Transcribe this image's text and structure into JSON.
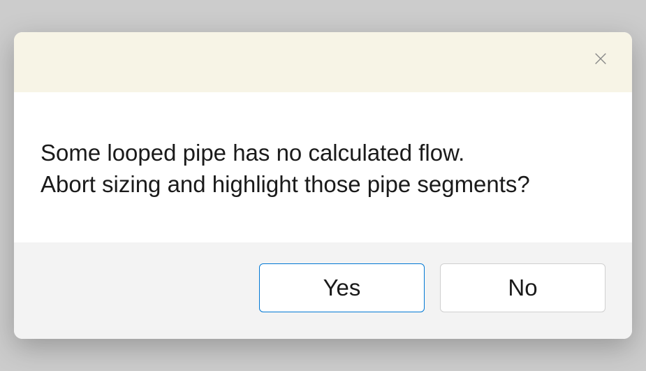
{
  "dialog": {
    "message": "Some looped pipe has no calculated flow.\nAbort sizing and highlight those pipe segments?",
    "buttons": {
      "yes": "Yes",
      "no": "No"
    }
  }
}
